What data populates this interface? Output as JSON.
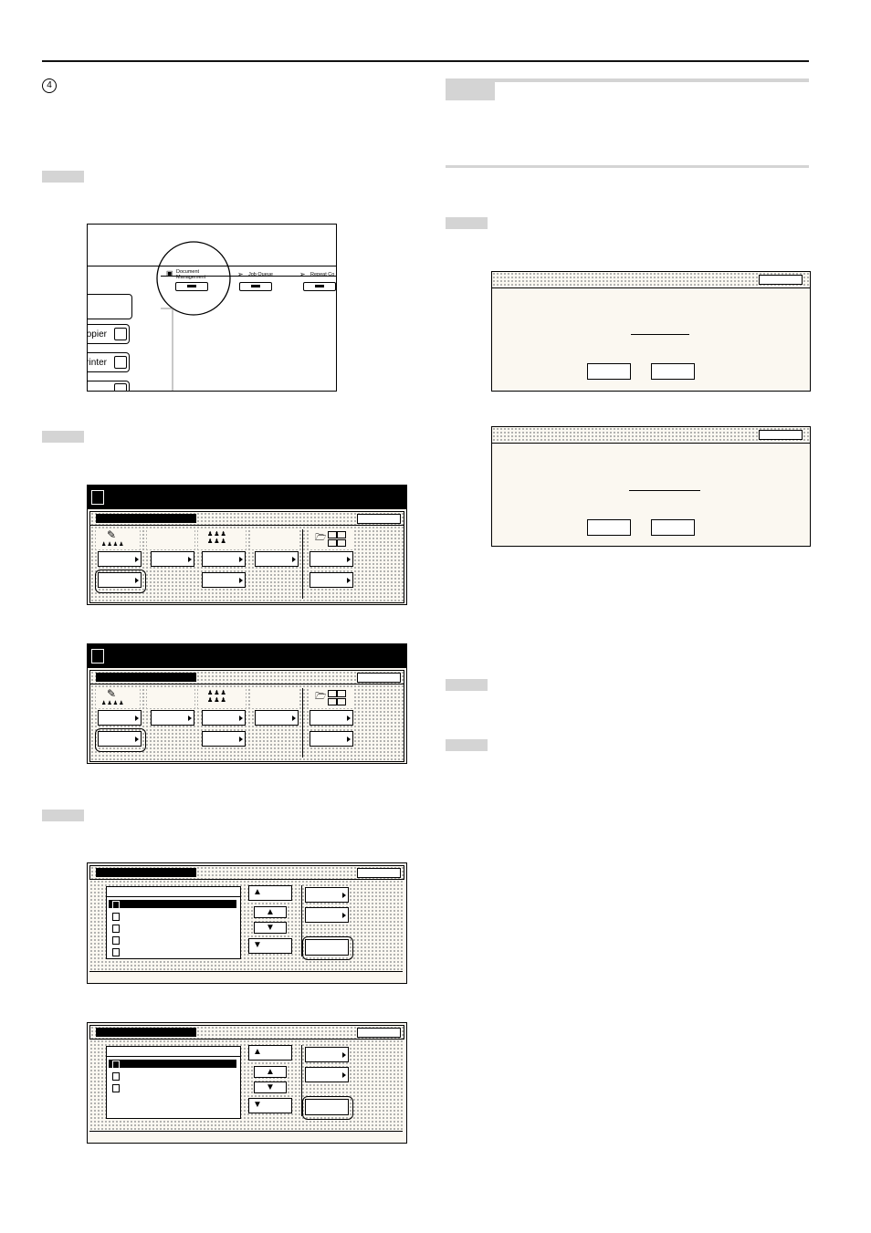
{
  "page": {
    "step_marker": "4"
  },
  "fig1": {
    "tabs": [
      {
        "label": "Document\nManagement",
        "icon": "document-management-icon"
      },
      {
        "label": "Job Queue",
        "icon": "job-queue-icon"
      },
      {
        "label": "Repeat Co",
        "icon": "repeat-copy-icon"
      }
    ],
    "modes": [
      {
        "label": "opier",
        "icon": "copier-icon"
      },
      {
        "label": "rinter",
        "icon": "printer-icon"
      }
    ]
  },
  "colors": {
    "step_bar": "#d4d4d4",
    "screen_bg": "#fbf8f1",
    "ink": "#000000"
  }
}
